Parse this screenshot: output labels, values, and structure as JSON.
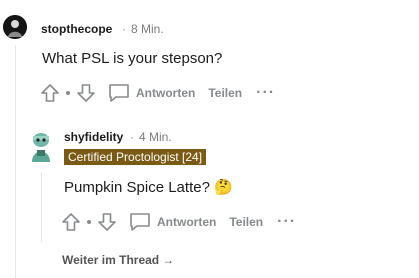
{
  "comment1": {
    "username": "stopthecope",
    "time": "8 Min.",
    "text": "What PSL is your stepson?",
    "actions": {
      "reply_label": "Antworten",
      "share_label": "Teilen"
    }
  },
  "comment2": {
    "username": "shyfidelity",
    "time": "4 Min.",
    "flair": "Certified Proctologist [24]",
    "text": "Pumpkin Spice Latte? 🤔",
    "actions": {
      "reply_label": "Antworten",
      "share_label": "Teilen"
    }
  },
  "continue_thread": {
    "label": "Weiter im Thread",
    "arrow": "→"
  },
  "separator": "·",
  "colors": {
    "flair_bg": "#7a5a14",
    "action_gray": "#878a8c",
    "thread_line": "#e6e6e6"
  },
  "icons": [
    "upvote-icon",
    "downvote-icon",
    "comment-icon",
    "more-icon",
    "arrow-right-icon"
  ]
}
